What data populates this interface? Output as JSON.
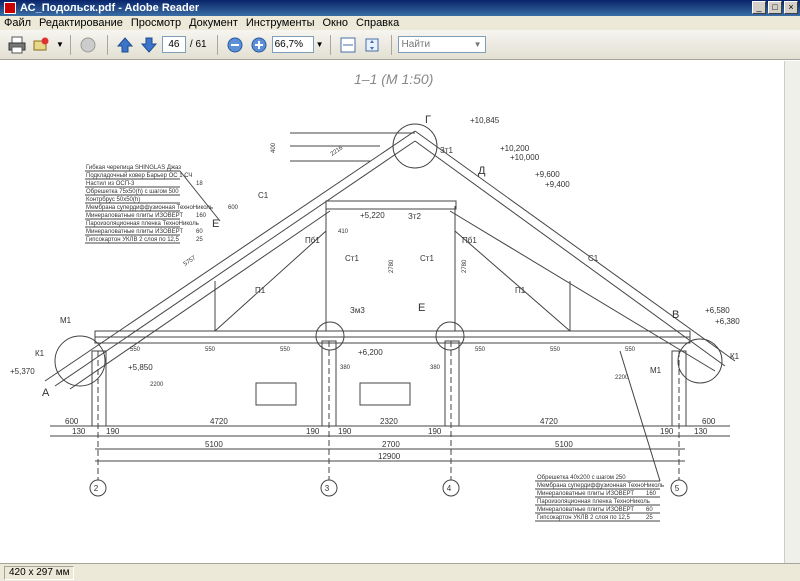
{
  "window": {
    "title": "АС_Подольск.pdf - Adobe Reader"
  },
  "menu": [
    "Файл",
    "Редактирование",
    "Просмотр",
    "Документ",
    "Инструменты",
    "Окно",
    "Справка"
  ],
  "toolbar": {
    "page_current": "46",
    "page_total": "/ 61",
    "zoom": "66,7%",
    "find_placeholder": "Найти"
  },
  "status": {
    "page_size": "420 x 297 мм"
  },
  "drawing": {
    "title": "1–1 (М 1:50)",
    "elevations": [
      "+10,845",
      "+10,200",
      "+10,000",
      "+9,600",
      "+9,400",
      "+6,580",
      "+6,380",
      "+5,370",
      "+5,850",
      "+5,220",
      "+6,200"
    ],
    "letters": [
      "Г",
      "Д",
      "Е",
      "Е",
      "В",
      "А"
    ],
    "roof_layers": [
      "Гибкая черепица SHINGLAS Джаз",
      "Подкладочный ковер Барьер ОС 1 СЧ",
      "Настил из ОСП-3",
      "Обрешетка 75х50(h) с шагом 500",
      "Контрбрус 50х50(h)",
      "Мембрана супердиффузионная ТехноНиколь",
      "Минераловатные плиты ИЗОВЕРТ",
      "Пароизоляционная пленка ТехноНиколь",
      "Минераловатные плиты ИЗОВЕРТ",
      "Гипсокартон УКЛВ 2 слоя по 12,5"
    ],
    "roof_layer_values": [
      "",
      "",
      "18",
      "",
      "",
      "",
      "160",
      "",
      "60",
      "25"
    ],
    "ceiling_layers": [
      "Обрешетка 40х200 с шагом 250",
      "Мембрана супердиффузионная ТехноНиколь",
      "Минераловатные плиты ИЗОВЕРТ",
      "Пароизоляционная пленка ТехноНиколь",
      "Минераловатные плиты ИЗОВЕРТ",
      "Гипсокартон УКЛВ 2 слоя по 12,5"
    ],
    "ceiling_layer_values": [
      "",
      "",
      "160",
      "",
      "60",
      "25"
    ],
    "dims_row1": [
      "600",
      "4720",
      "2320",
      "4720",
      "600"
    ],
    "dims_row2": [
      "130",
      "190",
      "190",
      "190",
      "190",
      "190",
      "130"
    ],
    "dims_row3": [
      "5100",
      "2700",
      "5100"
    ],
    "dims_total": "12900",
    "axes": [
      "2",
      "3",
      "4",
      "5"
    ],
    "member_labels": [
      "Ст1",
      "Ст1",
      "Зт1",
      "Зт2",
      "Пб1",
      "Пб1",
      "П1",
      "П1",
      "М1",
      "М1",
      "К1",
      "К1",
      "С1",
      "С1",
      "Зм3"
    ],
    "spacing_label": "550",
    "misc_dims": [
      "410",
      "2200",
      "2200",
      "380",
      "380",
      "2780",
      "2780",
      "5757",
      "600",
      "400",
      "2216"
    ]
  }
}
